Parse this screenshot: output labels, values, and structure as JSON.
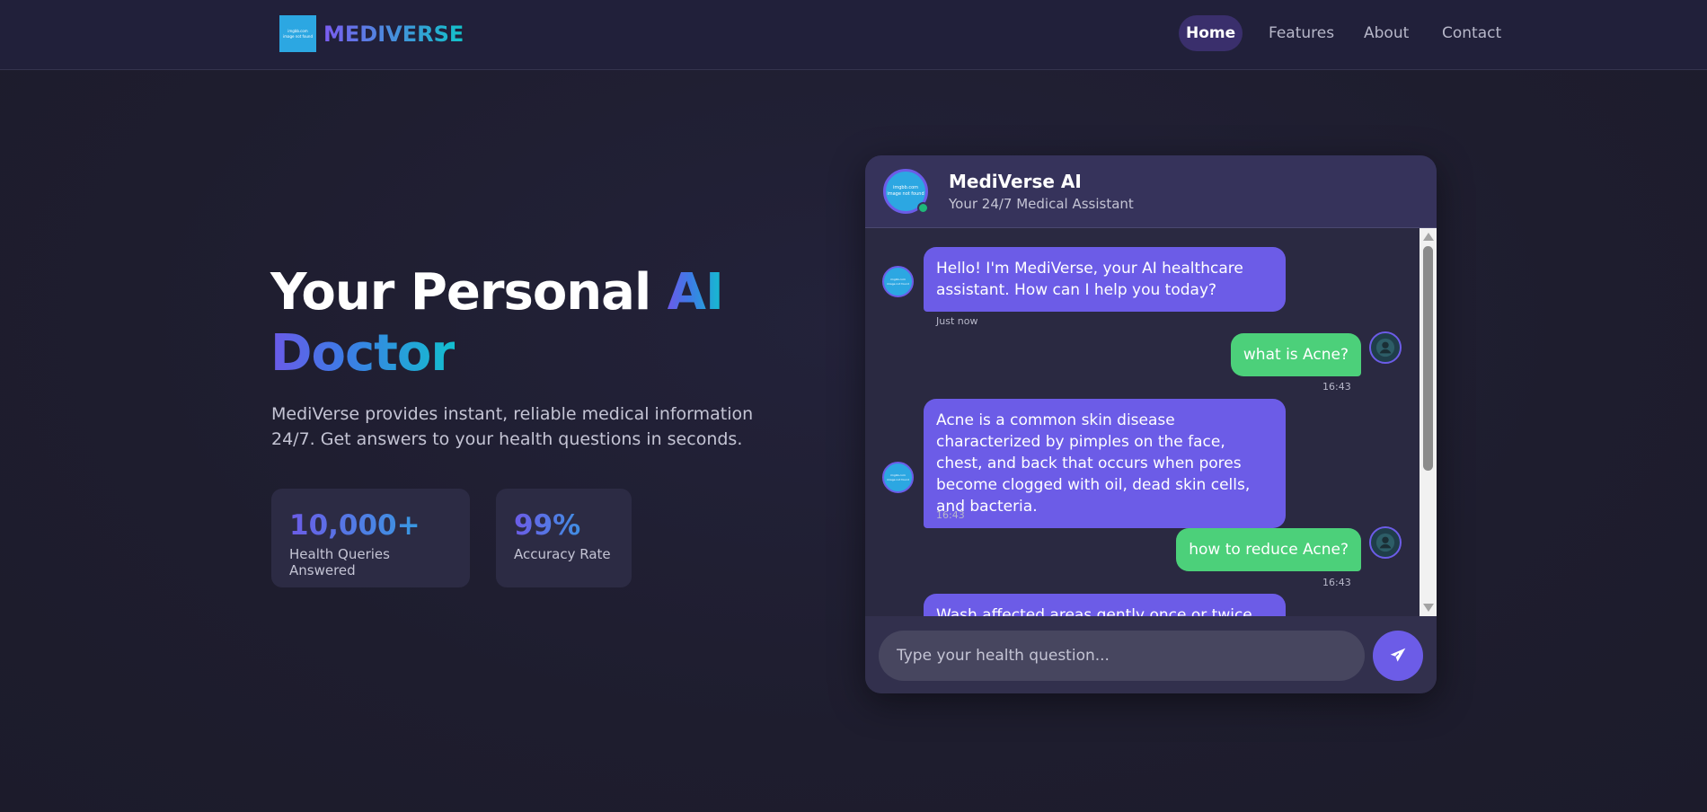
{
  "brand": {
    "name": "MEDIVERSE",
    "logo_alt_top": "imgbb.com",
    "logo_alt_bottom": "image not found"
  },
  "nav": {
    "items": [
      {
        "label": "Home",
        "active": true
      },
      {
        "label": "Features",
        "active": false
      },
      {
        "label": "About",
        "active": false
      },
      {
        "label": "Contact",
        "active": false
      }
    ]
  },
  "hero": {
    "title_part1": "Your Personal ",
    "title_highlight_1": "AI",
    "title_highlight_2": "Doctor",
    "subtitle": "MediVerse provides instant, reliable medical information 24/7. Get answers to your health questions in seconds.",
    "stats": [
      {
        "value": "10,000+",
        "label": "Health Queries Answered"
      },
      {
        "value": "99%",
        "label": "Accuracy Rate"
      }
    ]
  },
  "chat": {
    "title": "MediVerse AI",
    "status": "Your 24/7 Medical Assistant",
    "avatar_top": "imgbb.com",
    "avatar_bottom": "image not found",
    "messages": [
      {
        "from": "bot",
        "text": "Hello! I'm MediVerse, your AI healthcare assistant. How can I help you today?",
        "time": "Just now"
      },
      {
        "from": "user",
        "text": "what is Acne?",
        "time": "16:43"
      },
      {
        "from": "bot",
        "text": "Acne is a common skin disease characterized by pimples on the face, chest, and back that occurs when pores become clogged with oil, dead skin cells, and bacteria.",
        "time": "16:43"
      },
      {
        "from": "user",
        "text": "how to reduce Acne?",
        "time": "16:43"
      },
      {
        "from": "bot",
        "text": "Wash affected areas gently once or twice",
        "time": ""
      }
    ],
    "input_placeholder": "Type your health question...",
    "send_icon": "paper-plane-icon"
  },
  "colors": {
    "accent": "#6c5ce7",
    "user_bubble": "#4cd07a",
    "teal": "#12c2c9",
    "background": "#1e1d2e"
  }
}
